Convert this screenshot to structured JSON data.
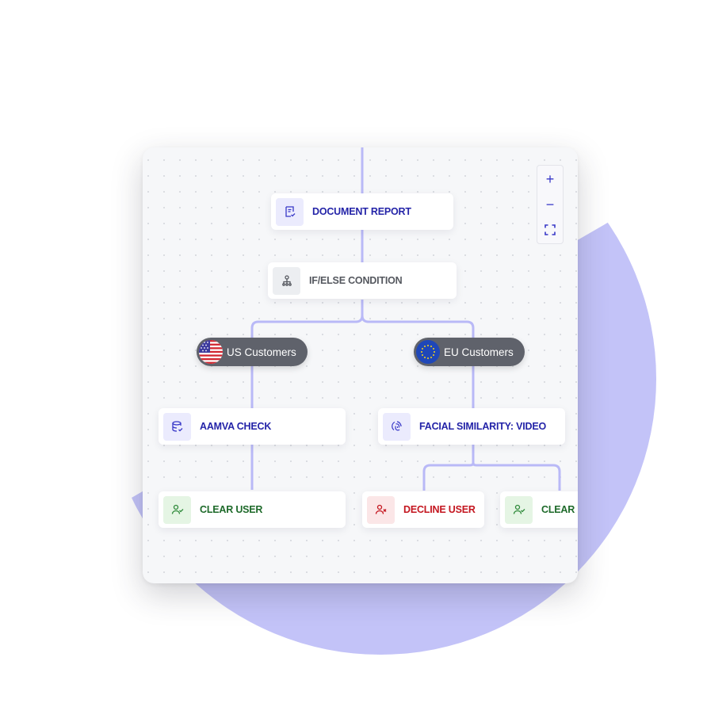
{
  "colors": {
    "accent": "#3838c8",
    "blob": "#c3c3f8",
    "wire": "#b9b9f7",
    "canvas_bg": "#f6f7f9",
    "pill_bg": "#5f626b"
  },
  "zoom_controls": {
    "zoom_in": "+",
    "zoom_out": "−",
    "fit_icon": "fit-screen-icon"
  },
  "nodes": {
    "document_report": {
      "label": "DOCUMENT REPORT",
      "icon": "document-check-icon"
    },
    "if_else": {
      "label": "IF/ELSE CONDITION",
      "icon": "branch-icon"
    },
    "aamva_check": {
      "label": "AAMVA CHECK",
      "icon": "database-check-icon"
    },
    "facial_similarity": {
      "label": "FACIAL SIMILARITY: VIDEO",
      "icon": "face-scan-icon"
    },
    "clear_user_us": {
      "label": "CLEAR USER",
      "icon": "user-check-icon"
    },
    "decline_user": {
      "label": "DECLINE USER",
      "icon": "user-x-icon"
    },
    "clear_user_eu": {
      "label": "CLEAR USER",
      "icon": "user-check-icon"
    }
  },
  "branches": {
    "us": {
      "label": "US Customers",
      "flag": "us-flag-icon"
    },
    "eu": {
      "label": "EU Customers",
      "flag": "eu-flag-icon"
    }
  }
}
